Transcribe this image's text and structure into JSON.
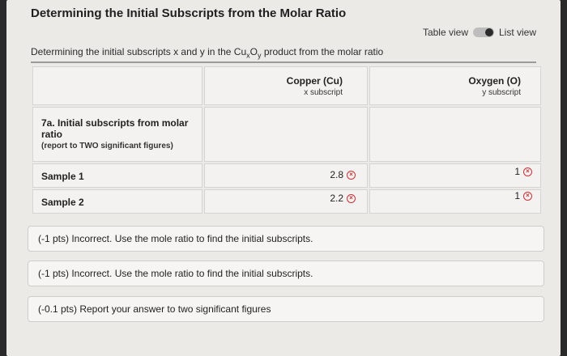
{
  "header": {
    "title": "Determining the Initial Subscripts from the Molar Ratio",
    "view_toggle": {
      "left_label": "Table view",
      "right_label": "List view",
      "selected": "List view"
    }
  },
  "subtitle": {
    "prefix": "Determining the initial subscripts x and y in the Cu",
    "sub_x": "x",
    "mid": "O",
    "sub_y": "y",
    "suffix": " product from the molar ratio"
  },
  "table": {
    "columns": [
      {
        "name": "Copper (Cu)",
        "sub": "x subscript"
      },
      {
        "name": "Oxygen (O)",
        "sub": "y subscript"
      }
    ],
    "section_label": "7a. Initial subscripts from molar ratio",
    "section_note": "(report to TWO significant figures)",
    "rows": [
      {
        "label": "Sample 1",
        "cu": "2.8",
        "o": "1"
      },
      {
        "label": "Sample 2",
        "cu": "2.2",
        "o": "1"
      }
    ]
  },
  "feedback": [
    "(-1 pts) Incorrect. Use the mole ratio to find the initial subscripts.",
    "(-1 pts) Incorrect. Use the mole ratio to find the initial subscripts.",
    "(-0.1 pts) Report your answer to two significant figures"
  ],
  "icons": {
    "wrong": "x-circle-icon"
  },
  "colors": {
    "error": "#c8323a"
  }
}
